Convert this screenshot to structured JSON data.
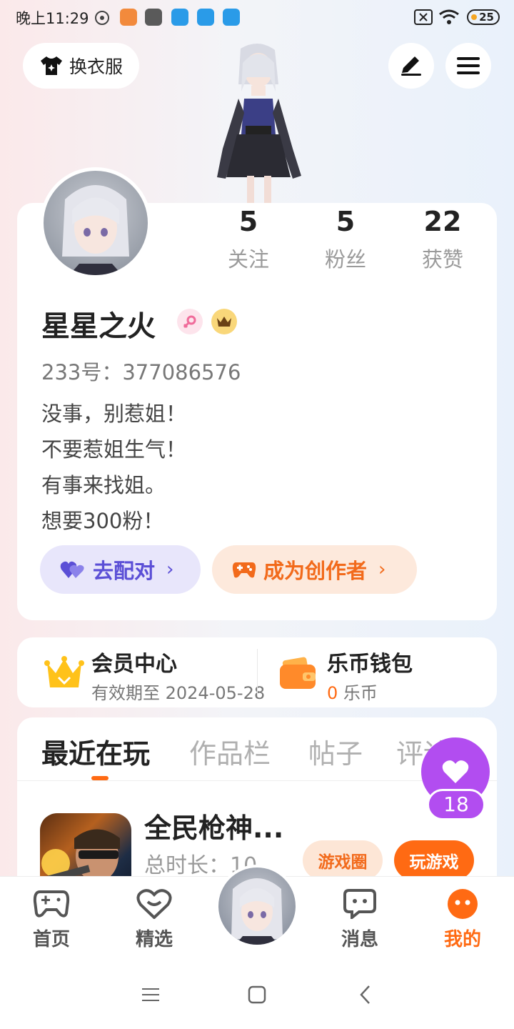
{
  "status_bar": {
    "time": "晚上11:29",
    "battery": "25"
  },
  "header": {
    "outfit_label": "换衣服"
  },
  "profile": {
    "stats": [
      {
        "value": "5",
        "label": "关注"
      },
      {
        "value": "5",
        "label": "粉丝"
      },
      {
        "value": "22",
        "label": "获赞"
      }
    ],
    "username": "星星之火",
    "uid": "233号：377086576",
    "bio": [
      "没事，别惹姐！",
      "不要惹姐生气！",
      "有事来找姐。",
      "想要300粉！"
    ],
    "match_button": "去配对",
    "creator_button": "成为创作者"
  },
  "vip": {
    "member_title": "会员中心",
    "member_sub": "有效期至 2024-05-28",
    "wallet_title": "乐币钱包",
    "wallet_amount": "0",
    "wallet_unit": " 乐币"
  },
  "tabs": [
    "最近在玩",
    "作品栏",
    "帖子",
    "评论"
  ],
  "recent_game": {
    "title": "全民枪神...",
    "sub": "总时长：10",
    "circle_button": "游戏圈",
    "play_button": "玩游戏"
  },
  "like_count": "18",
  "bottom_nav": [
    {
      "label": "首页"
    },
    {
      "label": "精选"
    },
    {
      "label": "消息"
    },
    {
      "label": "我的"
    }
  ],
  "colors": {
    "accent": "#ff6a13",
    "purple": "#b24df0",
    "match_bg": "#e8e6fb",
    "match_fg": "#5b4fd6",
    "creator_bg": "#fde9dc",
    "creator_fg": "#f26a1b"
  }
}
